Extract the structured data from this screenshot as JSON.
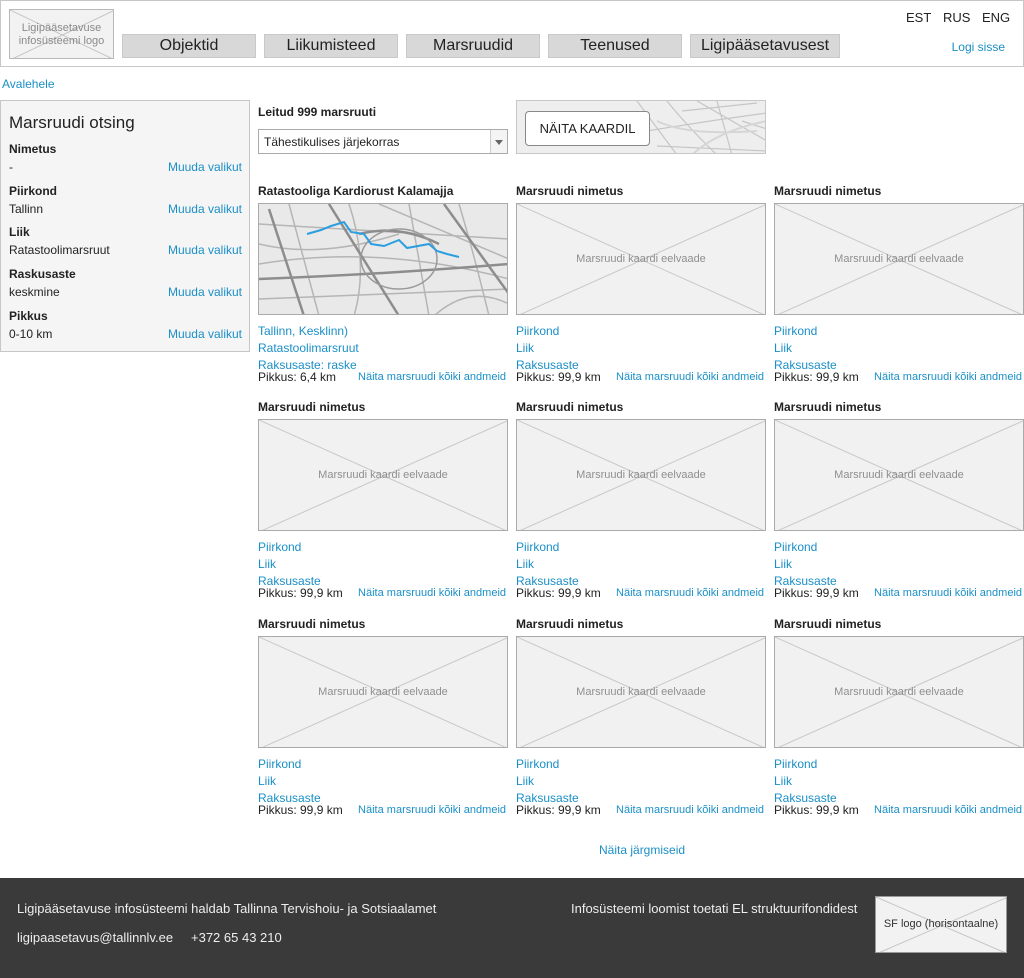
{
  "header": {
    "logo_text": "Ligipääsetavuse infosüsteemi logo",
    "nav": [
      "Objektid",
      "Liikumisteed",
      "Marsruudid",
      "Teenused",
      "Ligipääsetavusest"
    ],
    "languages": [
      "EST",
      "RUS",
      "ENG"
    ],
    "login": "Logi sisse"
  },
  "breadcrumb": "Avalehele",
  "sidebar": {
    "title": "Marsruudi otsing",
    "change_label": "Muuda valikut",
    "filters": [
      {
        "label": "Nimetus",
        "value": "-"
      },
      {
        "label": "Piirkond",
        "value": "Tallinn"
      },
      {
        "label": "Liik",
        "value": "Ratastoolimarsruut"
      },
      {
        "label": "Raskusaste",
        "value": "keskmine"
      },
      {
        "label": "Pikkus",
        "value": "0-10 km"
      }
    ]
  },
  "results": {
    "found": "Leitud 999 marsruuti",
    "sort_value": "Tähestikulises järjekorras",
    "map_button": "NÄITA KAARDIL",
    "image_placeholder": "Marsruudi kaardi eelvaade",
    "more_link": "Näita marsruudi kõiki andmeid",
    "next": "Näita järgmiseid",
    "cards": [
      {
        "title": "Ratastooliga Kardiorust Kalamajja",
        "area": "Tallinn, Kesklinn)",
        "type": "Ratastoolimarsruut",
        "difficulty": "Raksusaste: raske",
        "length": "Pikkus: 6,4 km",
        "map": true
      },
      {
        "title": "Marsruudi nimetus",
        "area": "Piirkond",
        "type": "Liik",
        "difficulty": "Raksusaste",
        "length": "Pikkus: 99,9 km",
        "map": false
      },
      {
        "title": "Marsruudi nimetus",
        "area": "Piirkond",
        "type": "Liik",
        "difficulty": "Raksusaste",
        "length": "Pikkus: 99,9 km",
        "map": false
      },
      {
        "title": "Marsruudi nimetus",
        "area": "Piirkond",
        "type": "Liik",
        "difficulty": "Raksusaste",
        "length": "Pikkus: 99,9 km",
        "map": false
      },
      {
        "title": "Marsruudi nimetus",
        "area": "Piirkond",
        "type": "Liik",
        "difficulty": "Raksusaste",
        "length": "Pikkus: 99,9 km",
        "map": false
      },
      {
        "title": "Marsruudi nimetus",
        "area": "Piirkond",
        "type": "Liik",
        "difficulty": "Raksusaste",
        "length": "Pikkus: 99,9 km",
        "map": false
      },
      {
        "title": "Marsruudi nimetus",
        "area": "Piirkond",
        "type": "Liik",
        "difficulty": "Raksusaste",
        "length": "Pikkus: 99,9 km",
        "map": false
      },
      {
        "title": "Marsruudi nimetus",
        "area": "Piirkond",
        "type": "Liik",
        "difficulty": "Raksusaste",
        "length": "Pikkus: 99,9 km",
        "map": false
      },
      {
        "title": "Marsruudi nimetus",
        "area": "Piirkond",
        "type": "Liik",
        "difficulty": "Raksusaste",
        "length": "Pikkus: 99,9 km",
        "map": false
      }
    ]
  },
  "footer": {
    "maintainer": "Ligipääsetavuse infosüsteemi haldab Tallinna Tervishoiu- ja Sotsiaalamet",
    "email": "ligipaasetavus@tallinnlv.ee",
    "phone": "+372 65 43 210",
    "funding": "Infosüsteemi loomist toetati EL struktuurifondidest",
    "sf_logo": "SF logo (horisontaalne)"
  },
  "colors": {
    "link": "#1a8fc7",
    "footer_bg": "#3a3a3a",
    "nav_bg": "#d8d8d8",
    "route": "#2a9ee0"
  }
}
